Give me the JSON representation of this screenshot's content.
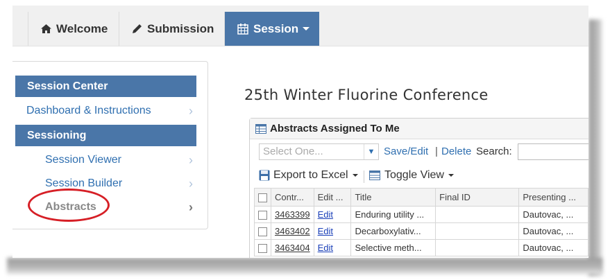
{
  "nav": {
    "tabs": [
      {
        "label": "Welcome",
        "icon": "home-icon"
      },
      {
        "label": "Submission",
        "icon": "pencil-icon"
      },
      {
        "label": "Session",
        "icon": "calendar-icon",
        "active": true
      }
    ]
  },
  "sidebar": {
    "sections": [
      {
        "heading": "Session Center"
      },
      {
        "heading": "Sessioning"
      }
    ],
    "items": [
      {
        "label": "Dashboard & Instructions"
      },
      {
        "label": "Session Viewer"
      },
      {
        "label": "Session Builder"
      },
      {
        "label": "Abstracts",
        "active": true
      }
    ]
  },
  "main": {
    "title": "25th Winter Fluorine Conference",
    "panel": {
      "heading": "Abstracts Assigned To Me",
      "select_placeholder": "Select One...",
      "save_edit": "Save/Edit",
      "separator": "|",
      "delete": "Delete",
      "search_label": "Search:",
      "search_value": "",
      "export_label": "Export to Excel",
      "toggle_label": "Toggle View"
    },
    "table": {
      "columns": [
        "Contr...",
        "Edit ...",
        "Title",
        "Final ID",
        "Presenting ..."
      ],
      "rows": [
        {
          "control": "3463399",
          "edit": "Edit",
          "title": "Enduring utility ...",
          "final_id": "",
          "presenting": "Dautovac, ..."
        },
        {
          "control": "3463402",
          "edit": "Edit",
          "title": "Decarboxylativ...",
          "final_id": "",
          "presenting": "Dautovac, ..."
        },
        {
          "control": "3463404",
          "edit": "Edit",
          "title": "Selective meth...",
          "final_id": "",
          "presenting": "Dautovac, ..."
        }
      ]
    }
  },
  "colors": {
    "accent": "#4a76a8",
    "link": "#2f6fb0",
    "highlight_oval": "#d61f26"
  }
}
